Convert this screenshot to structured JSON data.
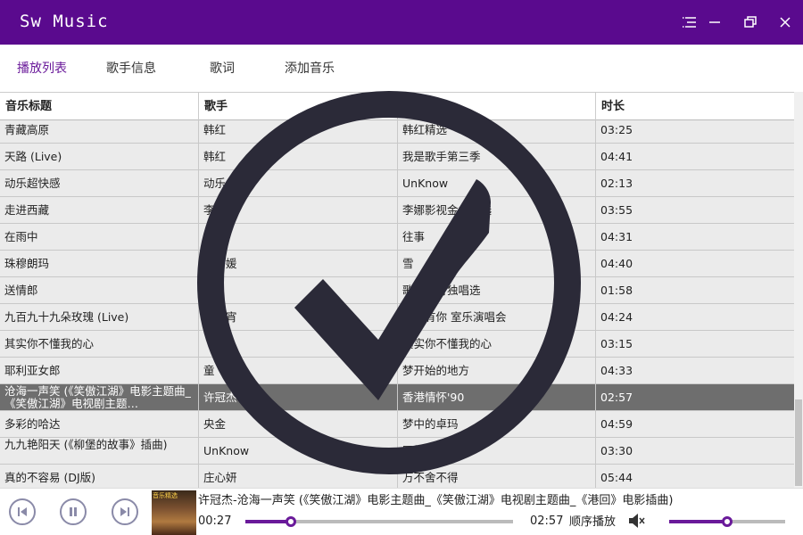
{
  "app": {
    "title": "Sw Music"
  },
  "window_controls": [
    "menu-icon",
    "minimize-icon",
    "restore-icon",
    "close-icon"
  ],
  "tabs": [
    {
      "label": "播放列表",
      "active": true
    },
    {
      "label": "歌手信息",
      "active": false
    },
    {
      "label": "歌词",
      "active": false
    },
    {
      "label": "添加音乐",
      "active": false
    }
  ],
  "table": {
    "headers": [
      "音乐标题",
      "歌手",
      "",
      "时长"
    ],
    "rows": [
      {
        "title": "青藏高原",
        "artist": "韩红",
        "album": "韩红精选",
        "duration": "03:25"
      },
      {
        "title": "天路 (Live)",
        "artist": "韩红",
        "album": "我是歌手第三季",
        "duration": "04:41"
      },
      {
        "title": "动乐超快感",
        "artist": "动乐",
        "album": "UnKnow",
        "duration": "02:13"
      },
      {
        "title": "走进西藏",
        "artist": "李娜",
        "album": "李娜影视金曲精选",
        "duration": "03:55"
      },
      {
        "title": "在雨中",
        "artist": "汪峰",
        "album": "往事",
        "duration": "04:31"
      },
      {
        "title": "珠穆朗玛",
        "artist": "李丹媛",
        "album": "雪",
        "duration": "04:40"
      },
      {
        "title": "送情郎",
        "artist": "",
        "album": "歌手孙青独唱选",
        "duration": "01:58"
      },
      {
        "title": "九百九十九朵玫瑰 (Live)",
        "artist": "邰正宵",
        "album": "重奏有你 室乐演唱会",
        "duration": "04:24"
      },
      {
        "title": "其实你不懂我的心",
        "artist": "",
        "album": "其实你不懂我的心",
        "duration": "03:15"
      },
      {
        "title": "耶利亚女郎",
        "artist": "童",
        "album": "梦开始的地方",
        "duration": "04:33"
      },
      {
        "title": "沧海一声笑 (《笑傲江湖》电影主题曲_《笑傲江湖》电视剧主题…",
        "artist": "许冠杰",
        "album": "香港情怀'90",
        "duration": "02:57",
        "selected": true
      },
      {
        "title": "多彩的哈达",
        "artist": "央金",
        "album": "梦中的卓玛",
        "duration": "04:59"
      },
      {
        "title": "九九艳阳天 (《柳堡的故事》插曲)",
        "artist": "UnKnow",
        "album": "国精品荟萃",
        "duration": "03:30"
      },
      {
        "title": "真的不容易 (DJ版)",
        "artist": "庄心妍",
        "album": "万不舍不得",
        "duration": "05:44"
      }
    ]
  },
  "player": {
    "cover_label": "音乐精选",
    "now_playing": "许冠杰-沧海一声笑 (《笑傲江湖》电影主题曲_《笑傲江湖》电视剧主题曲_《港回》电影插曲)",
    "current_time": "00:27",
    "total_time": "02:57",
    "progress_fraction": 0.17,
    "mode": "顺序播放",
    "volume_fraction": 0.5,
    "accent": "#6a1a9a"
  }
}
